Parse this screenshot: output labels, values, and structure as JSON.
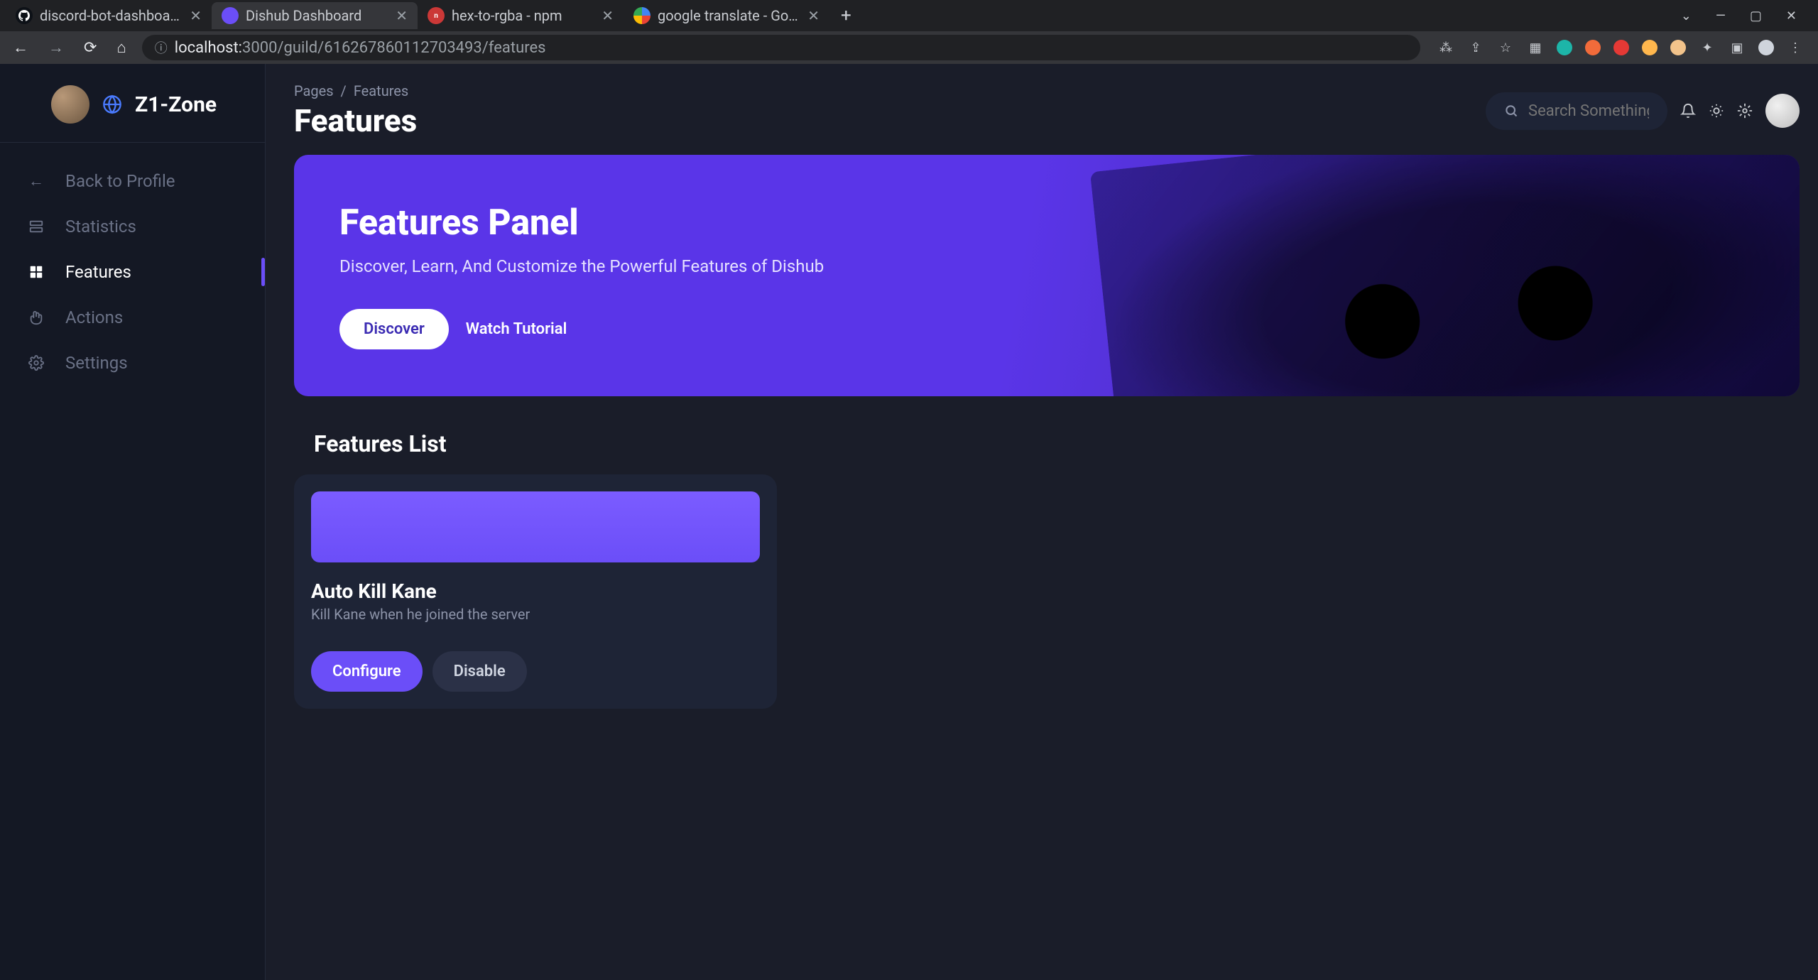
{
  "browser": {
    "tabs": [
      {
        "title": "discord-bot-dashboard-backe…",
        "active": false
      },
      {
        "title": "Dishub Dashboard",
        "active": true
      },
      {
        "title": "hex-to-rgba - npm",
        "active": false
      },
      {
        "title": "google translate - Google Sear…",
        "active": false
      }
    ],
    "url_prefix": "localhost:",
    "url_rest": "3000/guild/616267860112703493/features"
  },
  "sidebar": {
    "guild_name": "Z1-Zone",
    "items": [
      {
        "label": "Back to Profile",
        "icon": "arrow-left-icon"
      },
      {
        "label": "Statistics",
        "icon": "stats-icon"
      },
      {
        "label": "Features",
        "icon": "grid-icon"
      },
      {
        "label": "Actions",
        "icon": "hand-icon"
      },
      {
        "label": "Settings",
        "icon": "gear-icon"
      }
    ]
  },
  "topbar": {
    "breadcrumb_root": "Pages",
    "breadcrumb_sep": "/",
    "breadcrumb_leaf": "Features",
    "page_title": "Features",
    "search_placeholder": "Search Something..."
  },
  "banner": {
    "title": "Features Panel",
    "subtitle": "Discover, Learn, And Customize the Powerful Features of Dishub",
    "discover_label": "Discover",
    "watch_label": "Watch Tutorial"
  },
  "features": {
    "section_title": "Features List",
    "cards": [
      {
        "title": "Auto Kill Kane",
        "description": "Kill Kane when he joined the server",
        "configure_label": "Configure",
        "disable_label": "Disable"
      }
    ]
  }
}
